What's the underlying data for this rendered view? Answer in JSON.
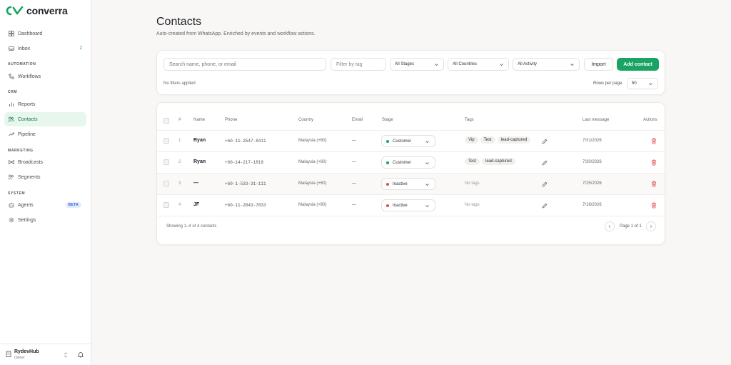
{
  "app": {
    "brand": "converra",
    "brand_color": "#19a463"
  },
  "sidebar": {
    "items": [
      {
        "label": "Dashboard",
        "icon": "grid-icon"
      },
      {
        "label": "Inbox",
        "icon": "inbox-icon",
        "count": "2"
      },
      {
        "label": "Workflows",
        "icon": "workflow-icon"
      },
      {
        "label": "Reports",
        "icon": "bar-chart-icon"
      },
      {
        "label": "Contacts",
        "icon": "users-icon",
        "active": true
      },
      {
        "label": "Pipeline",
        "icon": "trend-icon"
      },
      {
        "label": "Broadcasts",
        "icon": "broadcast-icon"
      },
      {
        "label": "Segments",
        "icon": "segments-icon"
      },
      {
        "label": "Agents",
        "icon": "agent-icon",
        "badge": "BETA"
      },
      {
        "label": "Settings",
        "icon": "gear-icon"
      }
    ],
    "sections": {
      "automation": "AUTOMATION",
      "crm": "CRM",
      "marketing": "MARKETING",
      "system": "SYSTEM"
    },
    "workspace": {
      "name": "RydevHub",
      "role": "Owner"
    }
  },
  "page": {
    "title": "Contacts",
    "subtitle": "Auto-created from WhatsApp. Enriched by events and workflow actions."
  },
  "filters": {
    "search_placeholder": "Search name, phone, or email",
    "tag_placeholder": "Filter by tag",
    "stages": "All Stages",
    "countries": "All Countries",
    "activity": "All Activity",
    "import_label": "Import",
    "add_label": "Add contact",
    "note": "No filters applied",
    "rows_per_page_label": "Rows per page",
    "rows_per_page_value": "50"
  },
  "table": {
    "columns": {
      "num": "#",
      "name": "Name",
      "phone": "Phone",
      "country": "Country",
      "email": "Email",
      "stage": "Stage",
      "tags": "Tags",
      "last_message": "Last message",
      "actions": "Actions"
    },
    "rows": [
      {
        "num": "1",
        "name": "Ryan",
        "phone": "+60-11-2547-8411",
        "country": "Malaysia (+60)",
        "email": "—",
        "stage": "Customer",
        "stage_color": "#19a463",
        "tags": [
          "Vip",
          "Test",
          "lead-captured"
        ],
        "no_tags": "",
        "last_message": "7/31/2026"
      },
      {
        "num": "2",
        "name": "Ryan",
        "phone": "+60-14-217-1819",
        "country": "Malaysia (+60)",
        "email": "—",
        "stage": "Customer",
        "stage_color": "#19a463",
        "tags": [
          "Test",
          "lead-captured"
        ],
        "no_tags": "",
        "last_message": "7/30/2026"
      },
      {
        "num": "3",
        "name": "—",
        "phone": "+60-1-533-31-111",
        "country": "Malaysia (+60)",
        "email": "—",
        "stage": "Inactive",
        "stage_color": "#e5484d",
        "tags": [],
        "no_tags": "No tags",
        "last_message": "7/25/2026"
      },
      {
        "num": "4",
        "name": "JF",
        "phone": "+60-11-2843-7833",
        "country": "Malaysia (+60)",
        "email": "—",
        "stage": "Inactive",
        "stage_color": "#e5484d",
        "tags": [],
        "no_tags": "No tags",
        "last_message": "7/16/2026"
      }
    ],
    "showing": "Showing 1–4 of 4 contacts",
    "page_label": "Page 1 of 1"
  }
}
